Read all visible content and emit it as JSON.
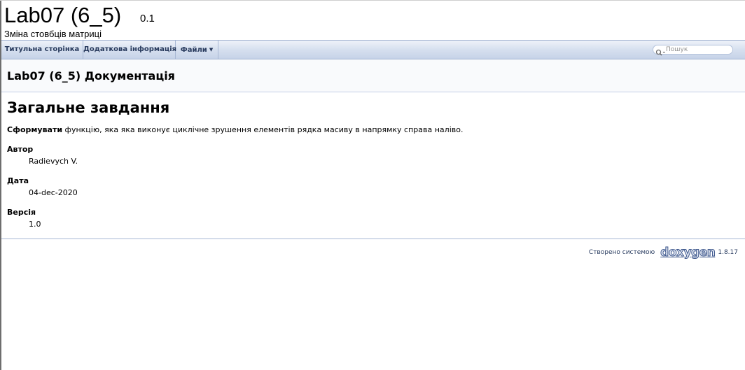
{
  "project": {
    "name": "Lab07 (6_5)",
    "number": "0.1",
    "brief": "Зміна стовбців матриці"
  },
  "nav": {
    "items": [
      {
        "label": "Титульна сторінка"
      },
      {
        "label": "Додаткова інформація"
      },
      {
        "label": "Файли"
      }
    ],
    "search_placeholder": "Пошук"
  },
  "header": {
    "title": "Lab07 (6_5) Документація"
  },
  "content": {
    "section_title": "Загальне завдання",
    "description_bold": "Сформувати",
    "description_rest": " функцію, яка яка виконує циклічне зрушення елементів рядка масиву в напрямку справа наліво.",
    "fields": [
      {
        "label": "Автор",
        "value": "Radievych V."
      },
      {
        "label": "Дата",
        "value": "04-dec-2020"
      },
      {
        "label": "Версія",
        "value": "1.0"
      }
    ]
  },
  "footer": {
    "generated_by": "Створено системою",
    "logo_text": "doxygen",
    "version": "1.8.17"
  },
  "colors": {
    "nav_text": "#283a5d",
    "nav_border": "#a8b8d4",
    "header_bg": "#f9fafc",
    "logo_stroke": "#3d578c"
  }
}
